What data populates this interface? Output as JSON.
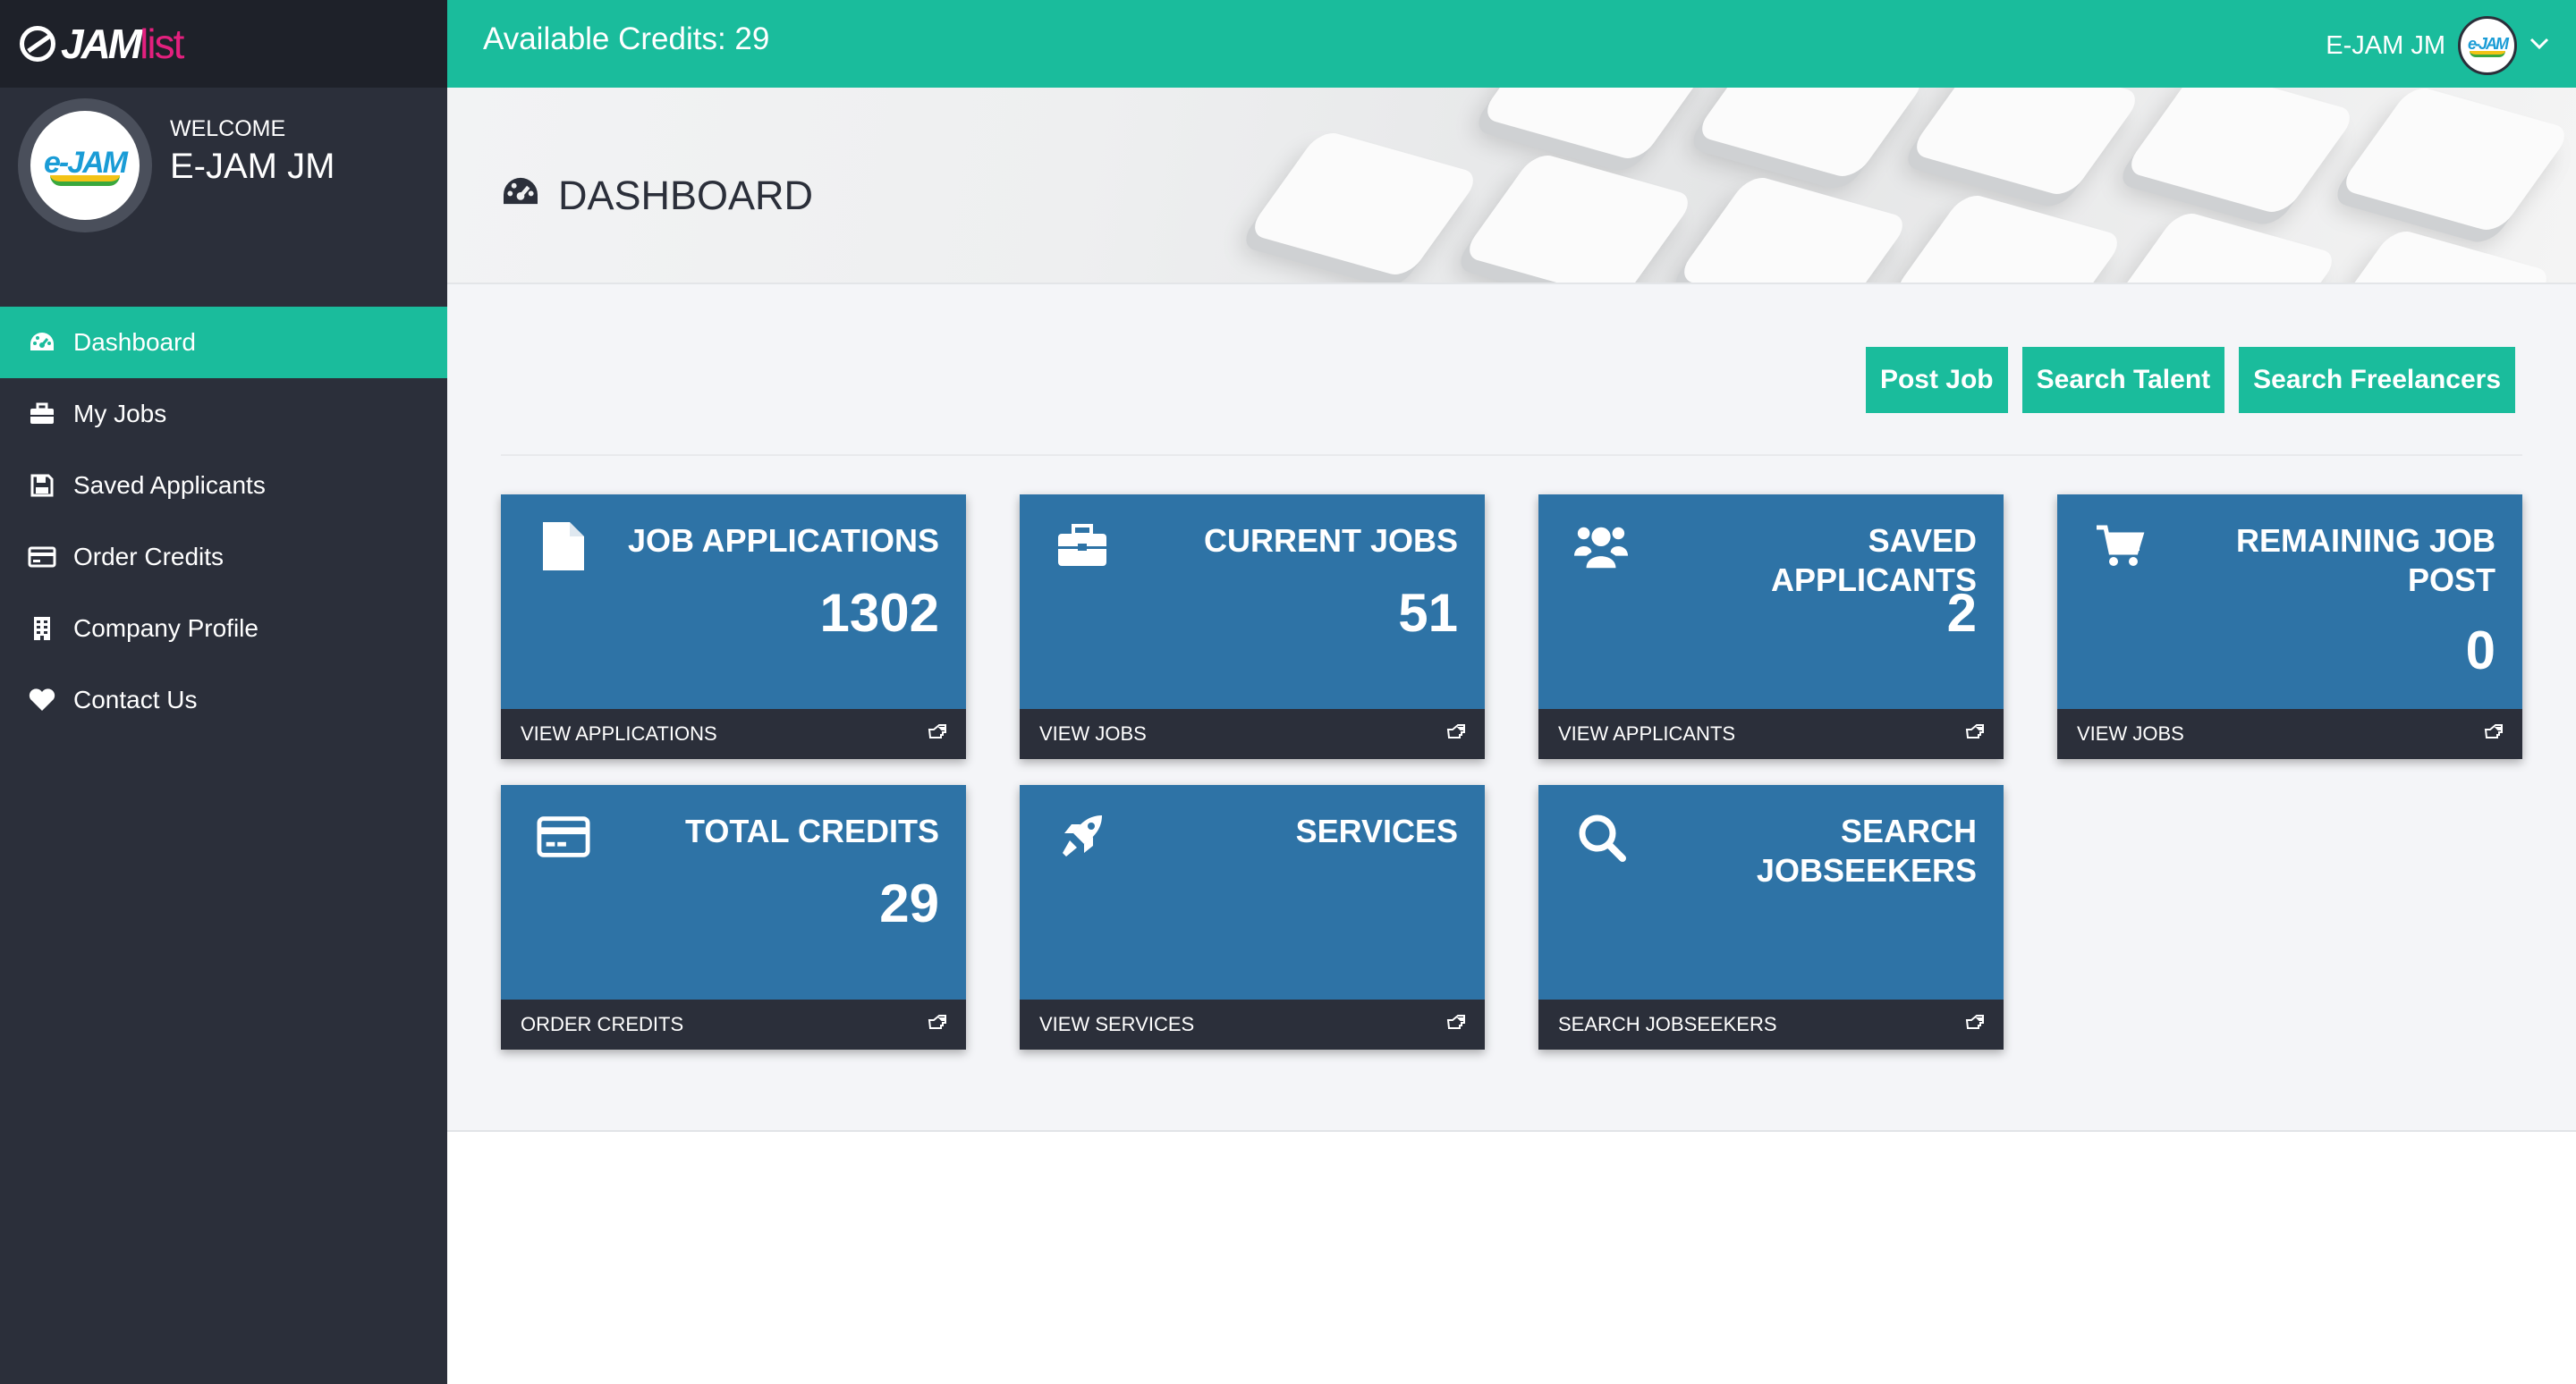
{
  "brand": {
    "word_main": "JAM",
    "word_accent": "list"
  },
  "profile": {
    "welcome": "WELCOME",
    "name": "E-JAM JM",
    "avatar_text": "e-JAM"
  },
  "sidebar": {
    "items": [
      {
        "label": "Dashboard",
        "icon": "dashboard-icon",
        "active": true
      },
      {
        "label": "My Jobs",
        "icon": "briefcase-icon"
      },
      {
        "label": "Saved Applicants",
        "icon": "floppy-disk-icon"
      },
      {
        "label": "Order Credits",
        "icon": "credit-card-icon"
      },
      {
        "label": "Company Profile",
        "icon": "building-icon"
      },
      {
        "label": "Contact Us",
        "icon": "heart-icon"
      }
    ]
  },
  "topbar": {
    "credits": "Available Credits: 29",
    "user_name": "E-JAM JM",
    "avatar_text": "e-JAM"
  },
  "hero": {
    "title": "DASHBOARD"
  },
  "actions": {
    "post_job": "Post Job",
    "search_talent": "Search Talent",
    "search_freelancers": "Search Freelancers"
  },
  "tiles": [
    {
      "title": "JOB APPLICATIONS",
      "value": "1302",
      "footer": "VIEW APPLICATIONS",
      "icon": "file-icon"
    },
    {
      "title": "CURRENT JOBS",
      "value": "51",
      "footer": "VIEW JOBS",
      "icon": "briefcase-icon"
    },
    {
      "title": "SAVED APPLICANTS",
      "value": "2",
      "footer": "VIEW APPLICANTS",
      "icon": "users-icon"
    },
    {
      "title": "REMAINING JOB POST",
      "value": "0",
      "footer": "VIEW JOBS",
      "icon": "cart-icon"
    },
    {
      "title": "TOTAL CREDITS",
      "value": "29",
      "footer": "ORDER CREDITS",
      "icon": "credit-card-icon"
    },
    {
      "title": "SERVICES",
      "value": "",
      "footer": "VIEW SERVICES",
      "icon": "rocket-icon"
    },
    {
      "title": "SEARCH JOBSEEKERS",
      "value": "",
      "footer": "SEARCH JOBSEEKERS",
      "icon": "search-icon"
    }
  ],
  "colors": {
    "accent": "#1abc9c",
    "sidebar": "#2b2f3a",
    "tile": "#2e73a6",
    "brand_accent": "#e3207e"
  }
}
